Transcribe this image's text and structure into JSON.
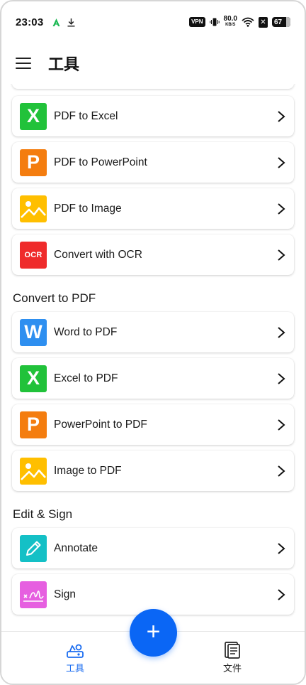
{
  "status": {
    "time": "23:03",
    "vpn_label": "VPN",
    "speed_value": "80.0",
    "speed_unit": "KB/S",
    "battery": "67"
  },
  "appbar": {
    "title": "工具"
  },
  "sections": {
    "convert_to_pdf": "Convert to PDF",
    "edit_sign": "Edit & Sign"
  },
  "items": {
    "pdf_to_excel": "PDF to Excel",
    "pdf_to_powerpoint": "PDF to PowerPoint",
    "pdf_to_image": "PDF to Image",
    "convert_with_ocr": "Convert with OCR",
    "word_to_pdf": "Word to PDF",
    "excel_to_pdf": "Excel to PDF",
    "powerpoint_to_pdf": "PowerPoint to PDF",
    "image_to_pdf": "Image to PDF",
    "annotate": "Annotate",
    "sign": "Sign"
  },
  "icons": {
    "excel_letter": "X",
    "powerpoint_letter": "P",
    "word_letter": "W",
    "ocr_text": "OCR"
  },
  "nav": {
    "tools": "工具",
    "files": "文件"
  },
  "fab": {
    "symbol": "+"
  },
  "colors": {
    "excel": "#21c23a",
    "powerpoint": "#f47d0f",
    "image": "#ffbf00",
    "ocr": "#ef2b2b",
    "word": "#2e8ff0",
    "annotate": "#14c0c6",
    "sign": "#e65fe0",
    "primary": "#0a66f5",
    "nav_active": "#1a6cf0"
  }
}
